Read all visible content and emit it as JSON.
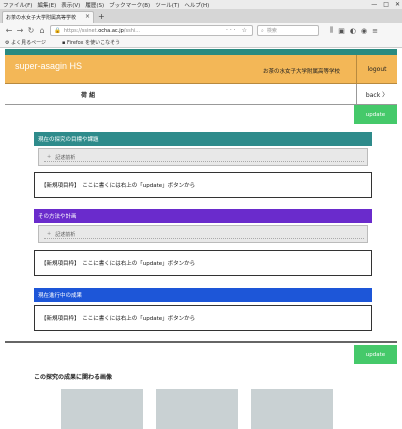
{
  "browser": {
    "menu": [
      "ファイル(F)",
      "編集(E)",
      "表示(V)",
      "履歴(S)",
      "ブックマーク(B)",
      "ツール(T)",
      "ヘルプ(H)"
    ],
    "window_controls": [
      "—",
      "□",
      "✕"
    ],
    "tab_title": "お茶の水女子大学附属高等学校",
    "url_gray_1": "https://ssinet.",
    "url_dark": "ocha.ac.jp",
    "url_gray_2": "/sshi...",
    "search_placeholder": "検索",
    "bookmarks": [
      "よく見るページ",
      "Firefox を使いこなそう"
    ]
  },
  "header": {
    "site_title": "super-asagin HS",
    "school_name": "お茶の水女子大学附属高等学校",
    "logout_label": "logout"
  },
  "subbar": {
    "page_title": "荷 組",
    "back_label": "back 〉"
  },
  "main": {
    "update_label": "update",
    "sections": [
      {
        "heading": "現在の探究の目標や課題",
        "row": "記述前析",
        "body": "【新規項目枠】　ここに書くには右上の「update」ボタンから",
        "color": "#2e8b8b"
      },
      {
        "heading": "その方法や計画",
        "row": "記述前析",
        "body": "【新規項目枠】　ここに書くには右上の「update」ボタンから",
        "color": "#6a2bcc"
      },
      {
        "heading": "現在進行中の成果",
        "body": "【新規項目枠】　ここに書くには右上の「update」ボタンから",
        "color": "#1d56d8"
      }
    ]
  },
  "lower": {
    "update_label": "update",
    "title": "この探究の成果に関わる画像"
  },
  "colors": {
    "accent_header": "#f3b757",
    "top_strip": "#2a8a80",
    "update_green": "#45c96a"
  }
}
